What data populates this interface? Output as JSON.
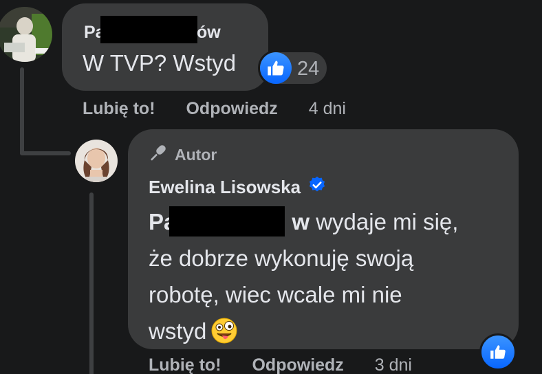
{
  "comment": {
    "author_prefix": "Pa",
    "author_suffix": "ów",
    "text": "W TVP? Wstyd",
    "reaction_count": "24",
    "actions": {
      "like": "Lubię to!",
      "reply": "Odpowiedz",
      "time": "4 dni"
    }
  },
  "reply": {
    "badge": "Autor",
    "author": "Ewelina Lisowska",
    "mention_prefix": "Pa",
    "mention_suffix": "w",
    "text_line1": " wydaje mi się,",
    "text_rest_1": "że dobrze wykonuję swoją",
    "text_rest_2": "robotę, wiec wcale mi nie",
    "text_rest_3": "wstyd",
    "actions": {
      "like": "Lubię to!",
      "reply": "Odpowiedz",
      "time": "3 dni"
    }
  },
  "colors": {
    "background": "#18191a",
    "bubble": "#3a3b3c",
    "like_blue": "#0866ff",
    "secondary_text": "#b0b3b8"
  }
}
